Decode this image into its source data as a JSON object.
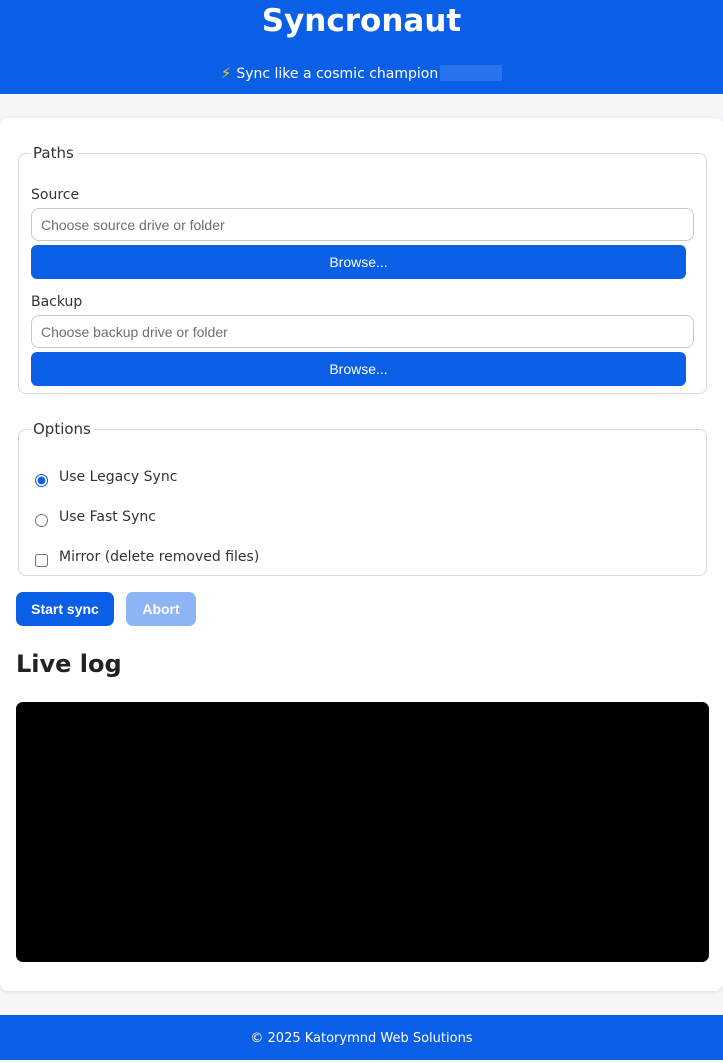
{
  "header": {
    "title": "Syncronaut",
    "tagline_icon": "lightning-bolt-icon",
    "tagline_glyph": "⚡",
    "tagline": "Sync like a cosmic champion"
  },
  "paths": {
    "legend": "Paths",
    "source": {
      "label": "Source",
      "value": "",
      "placeholder": "Choose source drive or folder",
      "browse_label": "Browse..."
    },
    "backup": {
      "label": "Backup",
      "value": "",
      "placeholder": "Choose backup drive or folder",
      "browse_label": "Browse..."
    }
  },
  "options": {
    "legend": "Options",
    "legacy_label": "Use Legacy Sync",
    "fast_label": "Use Fast Sync",
    "mirror_label": "Mirror (delete removed files)",
    "selected_mode": "Use Legacy Sync",
    "mirror_checked": false
  },
  "actions": {
    "start_label": "Start sync",
    "abort_label": "Abort"
  },
  "log": {
    "title": "Live log"
  },
  "footer": {
    "text": "© 2025 Katorymnd Web Solutions"
  },
  "colors": {
    "primary": "#0b5fe6",
    "primary_disabled": "#8db4f3",
    "log_background": "#000000",
    "page_background": "#f4f6fa"
  }
}
